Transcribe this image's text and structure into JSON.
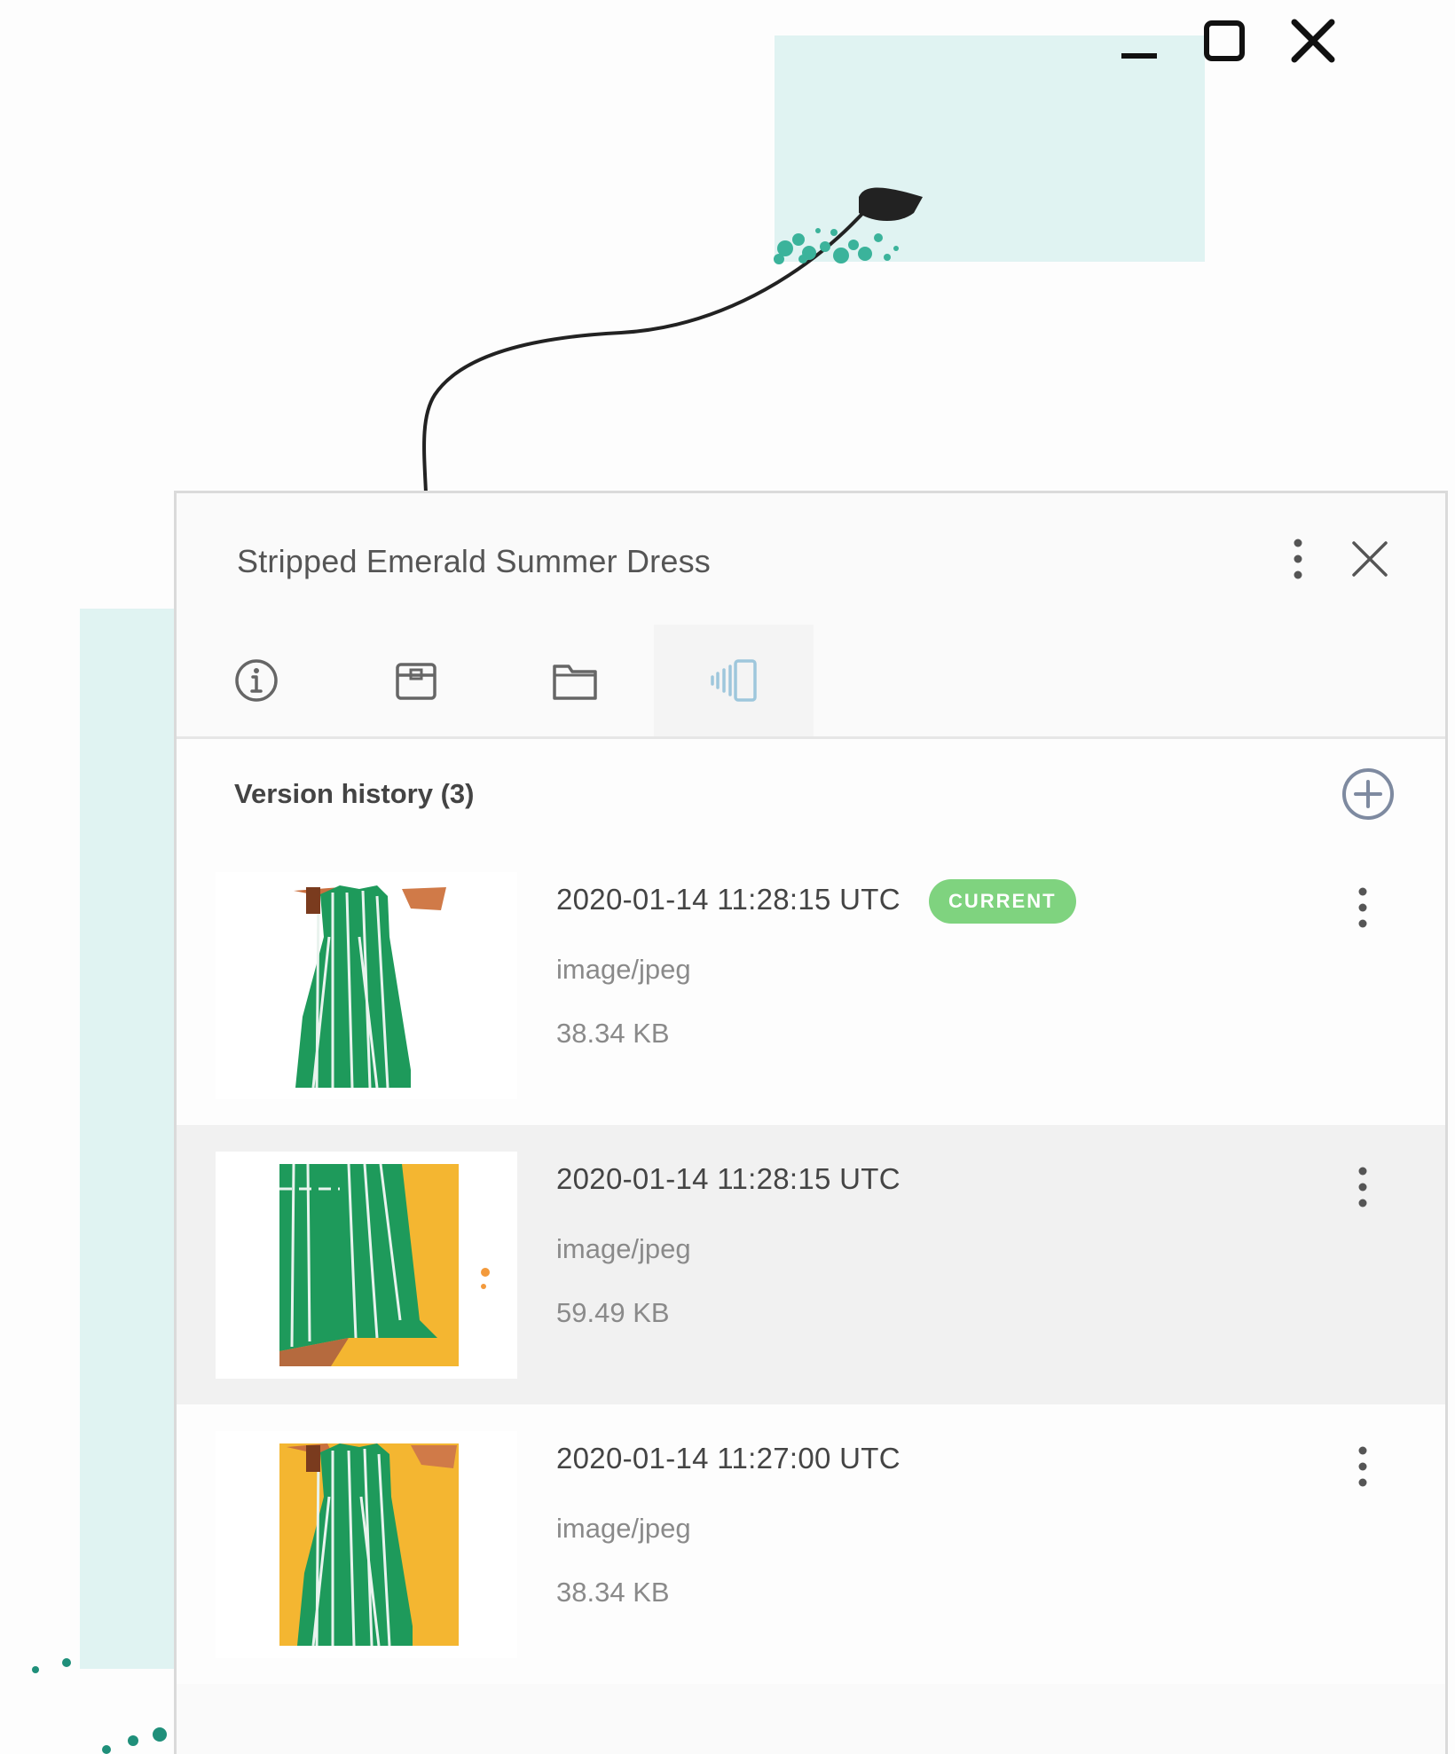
{
  "window_controls": {
    "minimize_icon": "minimize-icon",
    "maximize_icon": "maximize-icon",
    "close_icon": "close-icon"
  },
  "panel": {
    "title": "Stripped Emerald Summer Dress",
    "tabs": [
      {
        "icon": "info-icon",
        "active": false
      },
      {
        "icon": "package-icon",
        "active": false
      },
      {
        "icon": "folder-icon",
        "active": false
      },
      {
        "icon": "versions-icon",
        "active": true
      }
    ],
    "section_title": "Version history (3)",
    "versions": [
      {
        "date": "2020-01-14 11:28:15 UTC",
        "type": "image/jpeg",
        "size": "38.34 KB",
        "badge": "CURRENT",
        "thumb": "dress-yellow-white-bg"
      },
      {
        "date": "2020-01-14 11:28:15 UTC",
        "type": "image/jpeg",
        "size": "59.49 KB",
        "badge": "",
        "thumb": "dress-closeup-yellow"
      },
      {
        "date": "2020-01-14 11:27:00 UTC",
        "type": "image/jpeg",
        "size": "38.34 KB",
        "badge": "",
        "thumb": "dress-yellow-bg"
      }
    ]
  },
  "colors": {
    "accent_teal": "#e0f3f2",
    "badge_green": "#7fd37f",
    "active_tab_icon": "#9ec7dc",
    "dress_green": "#1e9a5b",
    "thumb_yellow": "#f4b631"
  }
}
